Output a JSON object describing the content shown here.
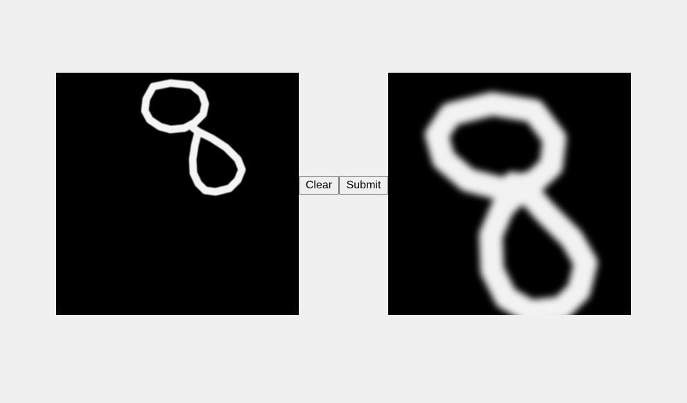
{
  "controls": {
    "clear_label": "Clear",
    "submit_label": "Submit"
  },
  "canvases": {
    "input_background": "#000000",
    "preview_background": "#000000",
    "stroke_color": "#ffffff"
  },
  "page": {
    "background": "#f0f0f0"
  }
}
